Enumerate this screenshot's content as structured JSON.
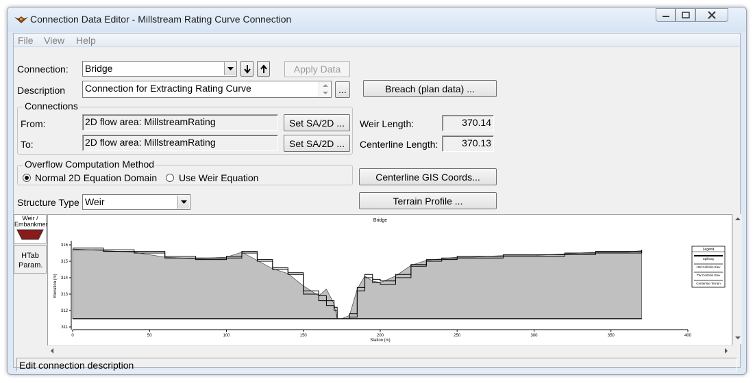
{
  "window": {
    "title": "Connection Data Editor - Millstream Rating Curve Connection",
    "icon": "hec-ras-icon",
    "controls": [
      "minimize-icon",
      "maximize-icon",
      "close-icon"
    ]
  },
  "menu": [
    "File",
    "View",
    "Help"
  ],
  "connection": {
    "label": "Connection:",
    "value": "Bridge",
    "apply_label": "Apply Data"
  },
  "description": {
    "label": "Description",
    "value": "Connection for Extracting Rating Curve",
    "ellipsis": "..."
  },
  "breach_label": "Breach (plan data) ...",
  "connections": {
    "title": "Connections",
    "from_label": "From:",
    "from_value": "2D flow area: MillstreamRating",
    "to_label": "To:",
    "to_value": "2D flow area: MillstreamRating",
    "set_label": "Set SA/2D ..."
  },
  "lengths": {
    "weir_label": "Weir Length:",
    "weir_value": "370.14",
    "centerline_label": "Centerline Length:",
    "centerline_value": "370.13"
  },
  "overflow": {
    "title": "Overflow Computation Method",
    "option1": "Normal 2D Equation Domain",
    "option2": "Use Weir Equation",
    "selected": 1
  },
  "gis_label": "Centerline GIS Coords...",
  "terrain_label": "Terrain Profile ...",
  "structure": {
    "label": "Structure Type",
    "value": "Weir"
  },
  "tabs": {
    "weir": "Weir / Embankment",
    "htab": "HTab Param."
  },
  "status": "Edit connection description",
  "chart_data": {
    "type": "area",
    "title": "Bridge",
    "xlabel": "Station (m)",
    "ylabel": "Elevation (m)",
    "xlim": [
      0,
      400
    ],
    "ylim": [
      311,
      316
    ],
    "x_ticks": [
      0,
      50,
      100,
      150,
      200,
      250,
      300,
      350,
      400
    ],
    "y_ticks": [
      311,
      312,
      313,
      314,
      315,
      316
    ],
    "legend_title": "Legend",
    "legend_position": "right",
    "series": [
      {
        "name": "Spillway",
        "x": [
          0,
          370
        ],
        "y": [
          311.5,
          311.5
        ]
      },
      {
        "name": "HW Cell Min Elev",
        "x": [
          0,
          20,
          40,
          60,
          80,
          100,
          110,
          120,
          130,
          140,
          150,
          160,
          165,
          170,
          172,
          175,
          180,
          185,
          190,
          195,
          200,
          210,
          220,
          230,
          240,
          250,
          260,
          280,
          300,
          320,
          340,
          360,
          370
        ],
        "y": [
          315.8,
          315.7,
          315.6,
          315.3,
          315.2,
          315.3,
          315.6,
          315.1,
          314.6,
          314.3,
          313.2,
          312.9,
          312.6,
          312.2,
          311.5,
          311.5,
          311.8,
          313.4,
          314.2,
          313.9,
          313.8,
          314.2,
          314.8,
          315.1,
          315.2,
          315.3,
          315.3,
          315.4,
          315.4,
          315.5,
          315.6,
          315.6,
          315.7
        ]
      },
      {
        "name": "TW Cell Min Elev",
        "x": [
          0,
          20,
          40,
          60,
          80,
          100,
          110,
          120,
          130,
          140,
          150,
          160,
          165,
          170,
          172,
          175,
          180,
          185,
          190,
          195,
          200,
          210,
          220,
          230,
          240,
          250,
          260,
          280,
          300,
          320,
          340,
          360,
          370
        ],
        "y": [
          315.7,
          315.6,
          315.5,
          315.2,
          315.1,
          315.2,
          315.5,
          315.0,
          314.5,
          314.2,
          313.0,
          312.6,
          312.3,
          312.0,
          311.5,
          311.5,
          311.6,
          313.2,
          314.0,
          313.7,
          313.6,
          314.0,
          314.7,
          315.0,
          315.1,
          315.2,
          315.2,
          315.3,
          315.3,
          315.4,
          315.5,
          315.5,
          315.6
        ]
      },
      {
        "name": "Centerline Terrain",
        "x": [
          0,
          20,
          40,
          60,
          80,
          100,
          110,
          120,
          130,
          140,
          150,
          160,
          165,
          170,
          172,
          175,
          180,
          185,
          190,
          195,
          200,
          210,
          220,
          230,
          240,
          250,
          260,
          280,
          300,
          320,
          340,
          360,
          370
        ],
        "y": [
          315.75,
          315.65,
          315.55,
          315.25,
          315.15,
          315.25,
          315.55,
          315.05,
          314.55,
          314.25,
          313.5,
          312.9,
          313.3,
          312.4,
          311.5,
          311.5,
          311.7,
          313.3,
          314.1,
          313.8,
          313.7,
          314.1,
          314.75,
          315.05,
          315.15,
          315.25,
          315.25,
          315.35,
          315.35,
          315.45,
          315.55,
          315.55,
          315.65
        ]
      }
    ]
  }
}
